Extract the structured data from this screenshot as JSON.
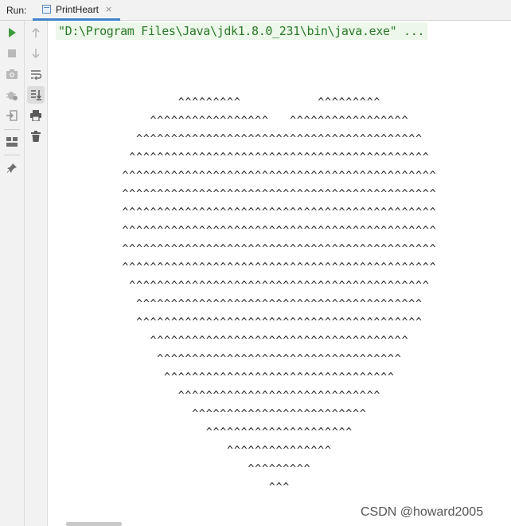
{
  "window": {
    "run_label": "Run:",
    "tab_label": "PrintHeart",
    "tab_close": "×"
  },
  "console": {
    "command": "\"D:\\Program Files\\Java\\jdk1.8.0_231\\bin\\java.exe\" ...",
    "output_lines": [
      "^^^^^^^^^           ^^^^^^^^^",
      "^^^^^^^^^^^^^^^^^   ^^^^^^^^^^^^^^^^^",
      "^^^^^^^^^^^^^^^^^^^^^^^^^^^^^^^^^^^^^^^^^",
      "^^^^^^^^^^^^^^^^^^^^^^^^^^^^^^^^^^^^^^^^^^^",
      "^^^^^^^^^^^^^^^^^^^^^^^^^^^^^^^^^^^^^^^^^^^^^",
      "^^^^^^^^^^^^^^^^^^^^^^^^^^^^^^^^^^^^^^^^^^^^^",
      "^^^^^^^^^^^^^^^^^^^^^^^^^^^^^^^^^^^^^^^^^^^^^",
      "^^^^^^^^^^^^^^^^^^^^^^^^^^^^^^^^^^^^^^^^^^^^^",
      "^^^^^^^^^^^^^^^^^^^^^^^^^^^^^^^^^^^^^^^^^^^^^",
      "^^^^^^^^^^^^^^^^^^^^^^^^^^^^^^^^^^^^^^^^^^^^^",
      "^^^^^^^^^^^^^^^^^^^^^^^^^^^^^^^^^^^^^^^^^^^",
      "^^^^^^^^^^^^^^^^^^^^^^^^^^^^^^^^^^^^^^^^^",
      "^^^^^^^^^^^^^^^^^^^^^^^^^^^^^^^^^^^^^^^^^",
      "^^^^^^^^^^^^^^^^^^^^^^^^^^^^^^^^^^^^^",
      "^^^^^^^^^^^^^^^^^^^^^^^^^^^^^^^^^^^",
      "^^^^^^^^^^^^^^^^^^^^^^^^^^^^^^^^^",
      "^^^^^^^^^^^^^^^^^^^^^^^^^^^^^",
      "^^^^^^^^^^^^^^^^^^^^^^^^^",
      "^^^^^^^^^^^^^^^^^^^^^",
      "^^^^^^^^^^^^^^^",
      "^^^^^^^^^",
      "^^^"
    ]
  },
  "toolbar_icons": [
    "run-icon",
    "stop-icon",
    "camera-icon",
    "debug-icon",
    "login-icon",
    "layout-icon",
    "pin-icon",
    "up-arrow-icon",
    "down-arrow-icon",
    "soft-wrap-icon",
    "scroll-to-end-icon",
    "print-icon",
    "trash-icon"
  ],
  "colors": {
    "run_green": "#3c9b3c",
    "command_text": "#2b7a2b",
    "command_bg": "#edf7ea",
    "tab_underline": "#4083c9"
  },
  "watermark": "CSDN @howard2005"
}
